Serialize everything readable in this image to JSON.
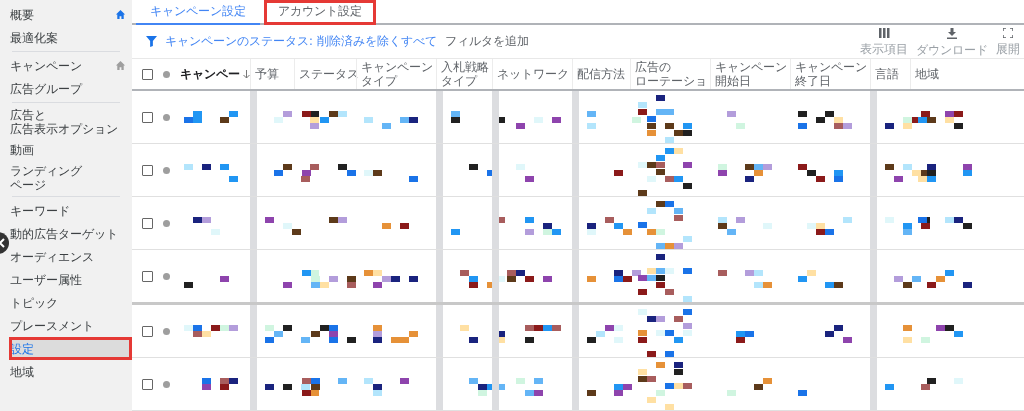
{
  "sidebar": {
    "items": [
      {
        "kind": "home_item",
        "lines": [
          "概要"
        ],
        "home_active": true,
        "selected": false,
        "highlighted": false
      },
      {
        "kind": "item",
        "lines": [
          "最適化案"
        ],
        "selected": false,
        "highlighted": false
      },
      {
        "kind": "divider"
      },
      {
        "kind": "home_item",
        "lines": [
          "キャンペーン"
        ],
        "home_active": false,
        "selected": false,
        "highlighted": false
      },
      {
        "kind": "item",
        "lines": [
          "広告グループ"
        ],
        "selected": false,
        "highlighted": false
      },
      {
        "kind": "divider"
      },
      {
        "kind": "item",
        "lines": [
          "広告と",
          "広告表示オプション"
        ],
        "selected": false,
        "highlighted": false
      },
      {
        "kind": "item",
        "lines": [
          "動画"
        ],
        "selected": false,
        "highlighted": false
      },
      {
        "kind": "item",
        "lines": [
          "ランディング",
          "ページ"
        ],
        "selected": false,
        "highlighted": false
      },
      {
        "kind": "divider"
      },
      {
        "kind": "item",
        "lines": [
          "キーワード"
        ],
        "selected": false,
        "highlighted": false
      },
      {
        "kind": "item",
        "lines": [
          "動的広告ターゲット"
        ],
        "selected": false,
        "highlighted": false
      },
      {
        "kind": "item",
        "lines": [
          "オーディエンス"
        ],
        "selected": false,
        "highlighted": false
      },
      {
        "kind": "item",
        "lines": [
          "ユーザー属性"
        ],
        "selected": false,
        "highlighted": false
      },
      {
        "kind": "item",
        "lines": [
          "トピック"
        ],
        "selected": false,
        "highlighted": false
      },
      {
        "kind": "item",
        "lines": [
          "プレースメント"
        ],
        "selected": false,
        "highlighted": false
      },
      {
        "kind": "item",
        "lines": [
          "設定"
        ],
        "selected": true,
        "highlighted": true
      },
      {
        "kind": "item",
        "lines": [
          "地域"
        ],
        "selected": false,
        "highlighted": false
      }
    ]
  },
  "tabs": [
    {
      "label": "キャンペーン設定",
      "selected": true,
      "highlighted": false
    },
    {
      "label": "アカウント設定",
      "selected": false,
      "highlighted": true
    }
  ],
  "filter": {
    "status": "キャンペーンのステータス: 削除済みを除くすべて",
    "add_label": "フィルタを追加"
  },
  "toolbar": [
    {
      "label": "表示項目"
    },
    {
      "label": "ダウンロード"
    },
    {
      "label": "展開"
    }
  ],
  "table": {
    "select_all_checked": false,
    "columns": [
      {
        "lines": [
          "キャンペー"
        ],
        "sorted": true
      },
      {
        "lines": [
          "予算"
        ],
        "sorted": false
      },
      {
        "lines": [
          "ステータス"
        ],
        "sorted": false
      },
      {
        "lines": [
          "キャンペーン",
          "タイプ"
        ],
        "sorted": false
      },
      {
        "lines": [
          "入札戦略",
          "タイプ"
        ],
        "sorted": false
      },
      {
        "lines": [
          "ネットワーク"
        ],
        "sorted": false
      },
      {
        "lines": [
          "配信方法"
        ],
        "sorted": false
      },
      {
        "lines": [
          "広告の",
          "ローテーショ"
        ],
        "sorted": false
      },
      {
        "lines": [
          "キャンペーン",
          "開始日"
        ],
        "sorted": false
      },
      {
        "lines": [
          "キャンペーン",
          "終了日"
        ],
        "sorted": false
      },
      {
        "lines": [
          "言語"
        ],
        "sorted": false
      },
      {
        "lines": [
          "地域"
        ],
        "sorted": false
      }
    ],
    "rows": [
      {
        "checked": false
      },
      {
        "checked": false
      },
      {
        "checked": false
      },
      {
        "checked": false
      },
      {
        "checked": false
      },
      {
        "checked": false
      }
    ]
  }
}
